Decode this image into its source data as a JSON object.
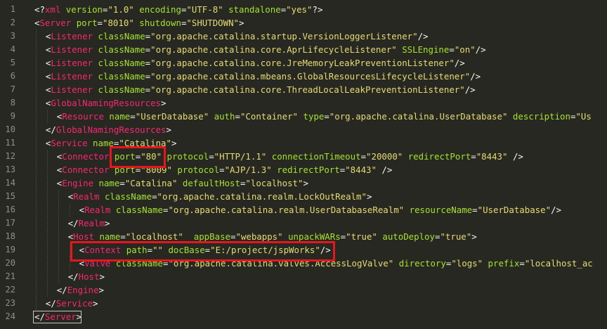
{
  "editor": {
    "line_numbers": [
      "1",
      "2",
      "3",
      "4",
      "5",
      "6",
      "7",
      "8",
      "9",
      "10",
      "11",
      "12",
      "13",
      "14",
      "15",
      "16",
      "17",
      "18",
      "19",
      "20",
      "21",
      "22",
      "23",
      "24"
    ],
    "lines": [
      {
        "indent": 0,
        "tokens": [
          [
            "pun",
            "<?"
          ],
          [
            "tag",
            "xml"
          ],
          [
            "pun",
            " "
          ],
          [
            "attr",
            "version"
          ],
          [
            "pun",
            "="
          ],
          [
            "str",
            "\"1.0\""
          ],
          [
            "pun",
            " "
          ],
          [
            "attr",
            "encoding"
          ],
          [
            "pun",
            "="
          ],
          [
            "str",
            "\"UTF-8\""
          ],
          [
            "pun",
            " "
          ],
          [
            "attr",
            "standalone"
          ],
          [
            "pun",
            "="
          ],
          [
            "str",
            "\"yes\""
          ],
          [
            "pun",
            "?>"
          ]
        ]
      },
      {
        "indent": 0,
        "tokens": [
          [
            "pun",
            "<"
          ],
          [
            "tag",
            "Server"
          ],
          [
            "pun",
            " "
          ],
          [
            "attr",
            "port"
          ],
          [
            "pun",
            "="
          ],
          [
            "str",
            "\"8010\""
          ],
          [
            "pun",
            " "
          ],
          [
            "attr",
            "shutdown"
          ],
          [
            "pun",
            "="
          ],
          [
            "str",
            "\"SHUTDOWN\""
          ],
          [
            "pun",
            ">"
          ]
        ]
      },
      {
        "indent": 1,
        "tokens": [
          [
            "pun",
            "<"
          ],
          [
            "tag",
            "Listener"
          ],
          [
            "pun",
            " "
          ],
          [
            "attr",
            "className"
          ],
          [
            "pun",
            "="
          ],
          [
            "str",
            "\"org.apache.catalina.startup.VersionLoggerListener\""
          ],
          [
            "pun",
            "/>"
          ]
        ]
      },
      {
        "indent": 1,
        "tokens": [
          [
            "pun",
            "<"
          ],
          [
            "tag",
            "Listener"
          ],
          [
            "pun",
            " "
          ],
          [
            "attr",
            "className"
          ],
          [
            "pun",
            "="
          ],
          [
            "str",
            "\"org.apache.catalina.core.AprLifecycleListener\""
          ],
          [
            "pun",
            " "
          ],
          [
            "attr",
            "SSLEngine"
          ],
          [
            "pun",
            "="
          ],
          [
            "str",
            "\"on\""
          ],
          [
            "pun",
            "/>"
          ]
        ]
      },
      {
        "indent": 1,
        "tokens": [
          [
            "pun",
            "<"
          ],
          [
            "tag",
            "Listener"
          ],
          [
            "pun",
            " "
          ],
          [
            "attr",
            "className"
          ],
          [
            "pun",
            "="
          ],
          [
            "str",
            "\"org.apache.catalina.core.JreMemoryLeakPreventionListener\""
          ],
          [
            "pun",
            "/>"
          ]
        ]
      },
      {
        "indent": 1,
        "tokens": [
          [
            "pun",
            "<"
          ],
          [
            "tag",
            "Listener"
          ],
          [
            "pun",
            " "
          ],
          [
            "attr",
            "className"
          ],
          [
            "pun",
            "="
          ],
          [
            "str",
            "\"org.apache.catalina.mbeans.GlobalResourcesLifecycleListener\""
          ],
          [
            "pun",
            "/>"
          ]
        ]
      },
      {
        "indent": 1,
        "tokens": [
          [
            "pun",
            "<"
          ],
          [
            "tag",
            "Listener"
          ],
          [
            "pun",
            " "
          ],
          [
            "attr",
            "className"
          ],
          [
            "pun",
            "="
          ],
          [
            "str",
            "\"org.apache.catalina.core.ThreadLocalLeakPreventionListener\""
          ],
          [
            "pun",
            "/>"
          ]
        ]
      },
      {
        "indent": 1,
        "tokens": [
          [
            "pun",
            "<"
          ],
          [
            "tag",
            "GlobalNamingResources"
          ],
          [
            "pun",
            ">"
          ]
        ]
      },
      {
        "indent": 2,
        "tokens": [
          [
            "pun",
            "<"
          ],
          [
            "tag",
            "Resource"
          ],
          [
            "pun",
            " "
          ],
          [
            "attr",
            "name"
          ],
          [
            "pun",
            "="
          ],
          [
            "str",
            "\"UserDatabase\""
          ],
          [
            "pun",
            " "
          ],
          [
            "attr",
            "auth"
          ],
          [
            "pun",
            "="
          ],
          [
            "str",
            "\"Container\""
          ],
          [
            "pun",
            " "
          ],
          [
            "attr",
            "type"
          ],
          [
            "pun",
            "="
          ],
          [
            "str",
            "\"org.apache.catalina.UserDatabase\""
          ],
          [
            "pun",
            " "
          ],
          [
            "attr",
            "description"
          ],
          [
            "pun",
            "="
          ],
          [
            "str",
            "\"Us"
          ]
        ]
      },
      {
        "indent": 1,
        "tokens": [
          [
            "pun",
            "</"
          ],
          [
            "tag",
            "GlobalNamingResources"
          ],
          [
            "pun",
            ">"
          ]
        ]
      },
      {
        "indent": 1,
        "tokens": [
          [
            "pun",
            "<"
          ],
          [
            "tag",
            "Service"
          ],
          [
            "pun",
            " "
          ],
          [
            "attr",
            "name"
          ],
          [
            "pun",
            "="
          ],
          [
            "str",
            "\"Catalina\""
          ],
          [
            "pun",
            ">"
          ]
        ]
      },
      {
        "indent": 2,
        "tokens": [
          [
            "pun",
            "<"
          ],
          [
            "tag",
            "Connector"
          ],
          [
            "pun",
            " "
          ],
          [
            "attr",
            "port"
          ],
          [
            "pun",
            "="
          ],
          [
            "str",
            "\"80\""
          ],
          [
            "pun",
            " "
          ],
          [
            "attr",
            "protocol"
          ],
          [
            "pun",
            "="
          ],
          [
            "str",
            "\"HTTP/1.1\""
          ],
          [
            "pun",
            " "
          ],
          [
            "attr",
            "connectionTimeout"
          ],
          [
            "pun",
            "="
          ],
          [
            "str",
            "\"20000\""
          ],
          [
            "pun",
            " "
          ],
          [
            "attr",
            "redirectPort"
          ],
          [
            "pun",
            "="
          ],
          [
            "str",
            "\"8443\""
          ],
          [
            "pun",
            " />"
          ]
        ]
      },
      {
        "indent": 2,
        "tokens": [
          [
            "pun",
            "<"
          ],
          [
            "tag",
            "Connector"
          ],
          [
            "pun",
            " "
          ],
          [
            "attr",
            "port"
          ],
          [
            "pun",
            "="
          ],
          [
            "str",
            "\"8009\""
          ],
          [
            "pun",
            " "
          ],
          [
            "attr",
            "protocol"
          ],
          [
            "pun",
            "="
          ],
          [
            "str",
            "\"AJP/1.3\""
          ],
          [
            "pun",
            " "
          ],
          [
            "attr",
            "redirectPort"
          ],
          [
            "pun",
            "="
          ],
          [
            "str",
            "\"8443\""
          ],
          [
            "pun",
            " />"
          ]
        ]
      },
      {
        "indent": 2,
        "tokens": [
          [
            "pun",
            "<"
          ],
          [
            "tag",
            "Engine"
          ],
          [
            "pun",
            " "
          ],
          [
            "attr",
            "name"
          ],
          [
            "pun",
            "="
          ],
          [
            "str",
            "\"Catalina\""
          ],
          [
            "pun",
            " "
          ],
          [
            "attr",
            "defaultHost"
          ],
          [
            "pun",
            "="
          ],
          [
            "str",
            "\"localhost\""
          ],
          [
            "pun",
            ">"
          ]
        ]
      },
      {
        "indent": 3,
        "tokens": [
          [
            "pun",
            "<"
          ],
          [
            "tag",
            "Realm"
          ],
          [
            "pun",
            " "
          ],
          [
            "attr",
            "className"
          ],
          [
            "pun",
            "="
          ],
          [
            "str",
            "\"org.apache.catalina.realm.LockOutRealm\""
          ],
          [
            "pun",
            ">"
          ]
        ]
      },
      {
        "indent": 4,
        "tokens": [
          [
            "pun",
            "<"
          ],
          [
            "tag",
            "Realm"
          ],
          [
            "pun",
            " "
          ],
          [
            "attr",
            "className"
          ],
          [
            "pun",
            "="
          ],
          [
            "str",
            "\"org.apache.catalina.realm.UserDatabaseRealm\""
          ],
          [
            "pun",
            " "
          ],
          [
            "attr",
            "resourceName"
          ],
          [
            "pun",
            "="
          ],
          [
            "str",
            "\"UserDatabase\""
          ],
          [
            "pun",
            "/>"
          ]
        ]
      },
      {
        "indent": 3,
        "tokens": [
          [
            "pun",
            "</"
          ],
          [
            "tag",
            "Realm"
          ],
          [
            "pun",
            ">"
          ]
        ]
      },
      {
        "indent": 3,
        "tokens": [
          [
            "pun",
            "<"
          ],
          [
            "tag",
            "Host"
          ],
          [
            "pun",
            " "
          ],
          [
            "attr",
            "name"
          ],
          [
            "pun",
            "="
          ],
          [
            "str",
            "\"localhost\""
          ],
          [
            "pun",
            "  "
          ],
          [
            "attr",
            "appBase"
          ],
          [
            "pun",
            "="
          ],
          [
            "str",
            "\"webapps\""
          ],
          [
            "pun",
            " "
          ],
          [
            "attr",
            "unpackWARs"
          ],
          [
            "pun",
            "="
          ],
          [
            "str",
            "\"true\""
          ],
          [
            "pun",
            " "
          ],
          [
            "attr",
            "autoDeploy"
          ],
          [
            "pun",
            "="
          ],
          [
            "str",
            "\"true\""
          ],
          [
            "pun",
            ">"
          ]
        ]
      },
      {
        "indent": 4,
        "tokens": [
          [
            "pun",
            "<"
          ],
          [
            "tag",
            "Context"
          ],
          [
            "pun",
            " "
          ],
          [
            "attr",
            "path"
          ],
          [
            "pun",
            "="
          ],
          [
            "str",
            "\"\""
          ],
          [
            "pun",
            " "
          ],
          [
            "attr",
            "docBase"
          ],
          [
            "pun",
            "="
          ],
          [
            "str",
            "\"E:/project/jspWorks\""
          ],
          [
            "pun",
            "/>"
          ]
        ]
      },
      {
        "indent": 4,
        "tokens": [
          [
            "pun",
            "<"
          ],
          [
            "tag",
            "Valve"
          ],
          [
            "pun",
            " "
          ],
          [
            "attr",
            "className"
          ],
          [
            "pun",
            "="
          ],
          [
            "str",
            "\"org.apache.catalina.valves.AccessLogValve\""
          ],
          [
            "pun",
            " "
          ],
          [
            "attr",
            "directory"
          ],
          [
            "pun",
            "="
          ],
          [
            "str",
            "\"logs\""
          ],
          [
            "pun",
            " "
          ],
          [
            "attr",
            "prefix"
          ],
          [
            "pun",
            "="
          ],
          [
            "str",
            "\"localhost_ac"
          ]
        ]
      },
      {
        "indent": 3,
        "tokens": [
          [
            "pun",
            "</"
          ],
          [
            "tag",
            "Host"
          ],
          [
            "pun",
            ">"
          ]
        ]
      },
      {
        "indent": 2,
        "tokens": [
          [
            "pun",
            "</"
          ],
          [
            "tag",
            "Engine"
          ],
          [
            "pun",
            ">"
          ]
        ]
      },
      {
        "indent": 1,
        "tokens": [
          [
            "pun",
            "</"
          ],
          [
            "tag",
            "Service"
          ],
          [
            "pun",
            ">"
          ]
        ]
      },
      {
        "indent": 0,
        "tokens": [
          [
            "pun",
            "</"
          ],
          [
            "tag",
            "Server"
          ],
          [
            "pun",
            ">"
          ]
        ]
      }
    ]
  },
  "colors": {
    "background": "#272822",
    "tag": "#f92672",
    "attribute": "#a6e22e",
    "string": "#e6db74",
    "punctuation": "#f8f8f2",
    "line_number": "#8f908a",
    "highlight": "#e8151c"
  }
}
